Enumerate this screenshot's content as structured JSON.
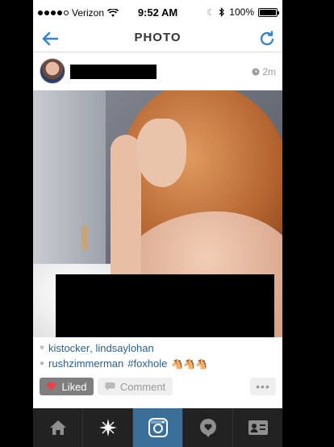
{
  "status_bar": {
    "carrier": "Verizon",
    "time": "9:52 AM",
    "battery": "100%"
  },
  "navbar": {
    "title": "PHOTO"
  },
  "post": {
    "time_ago": "2m",
    "likes": {
      "user1": "kistocker",
      "separator": ", ",
      "user2": "lindsaylohan"
    },
    "comment": {
      "user": "rushzimmerman",
      "hashtag": "#foxhole",
      "emoji": "🐴🐴🐴"
    }
  },
  "actions": {
    "liked_label": "Liked",
    "comment_label": "Comment",
    "more_label": "•••"
  },
  "tabs": [
    {
      "icon": "home-icon"
    },
    {
      "icon": "explore-icon"
    },
    {
      "icon": "camera-icon"
    },
    {
      "icon": "activity-icon"
    },
    {
      "icon": "profile-icon"
    }
  ],
  "colors": {
    "link": "#2b5f8d",
    "tab_active": "#3a6f9a",
    "tabbar_bg": "#222222",
    "nav_accent": "#3b82c4"
  }
}
